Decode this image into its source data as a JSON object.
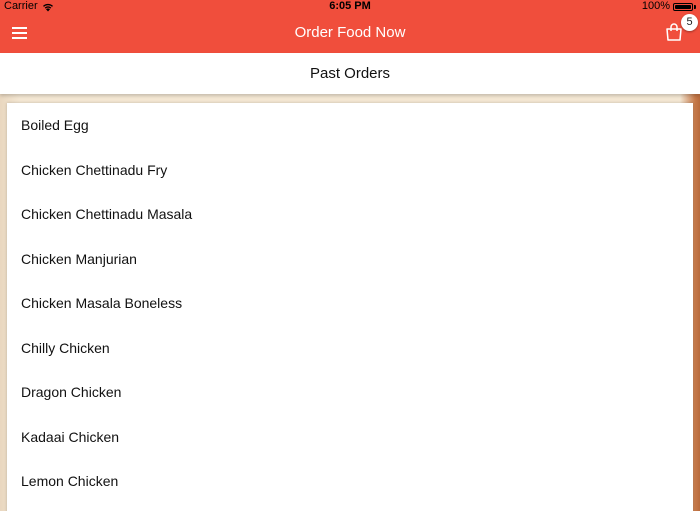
{
  "status_bar": {
    "carrier": "Carrier",
    "time": "6:05 PM",
    "battery": "100%"
  },
  "app_bar": {
    "title": "Order Food Now",
    "menu_icon": "hamburger-menu-icon",
    "cart_icon": "shopping-bag-icon",
    "cart_count": "5",
    "background_color": "#f04e3c"
  },
  "section": {
    "title": "Past Orders"
  },
  "past_orders": [
    "Boiled Egg",
    "Chicken Chettinadu Fry",
    "Chicken Chettinadu Masala",
    "Chicken Manjurian",
    "Chicken Masala Boneless",
    "Chilly Chicken",
    "Dragon Chicken",
    "Kadaai Chicken",
    "Lemon Chicken"
  ]
}
